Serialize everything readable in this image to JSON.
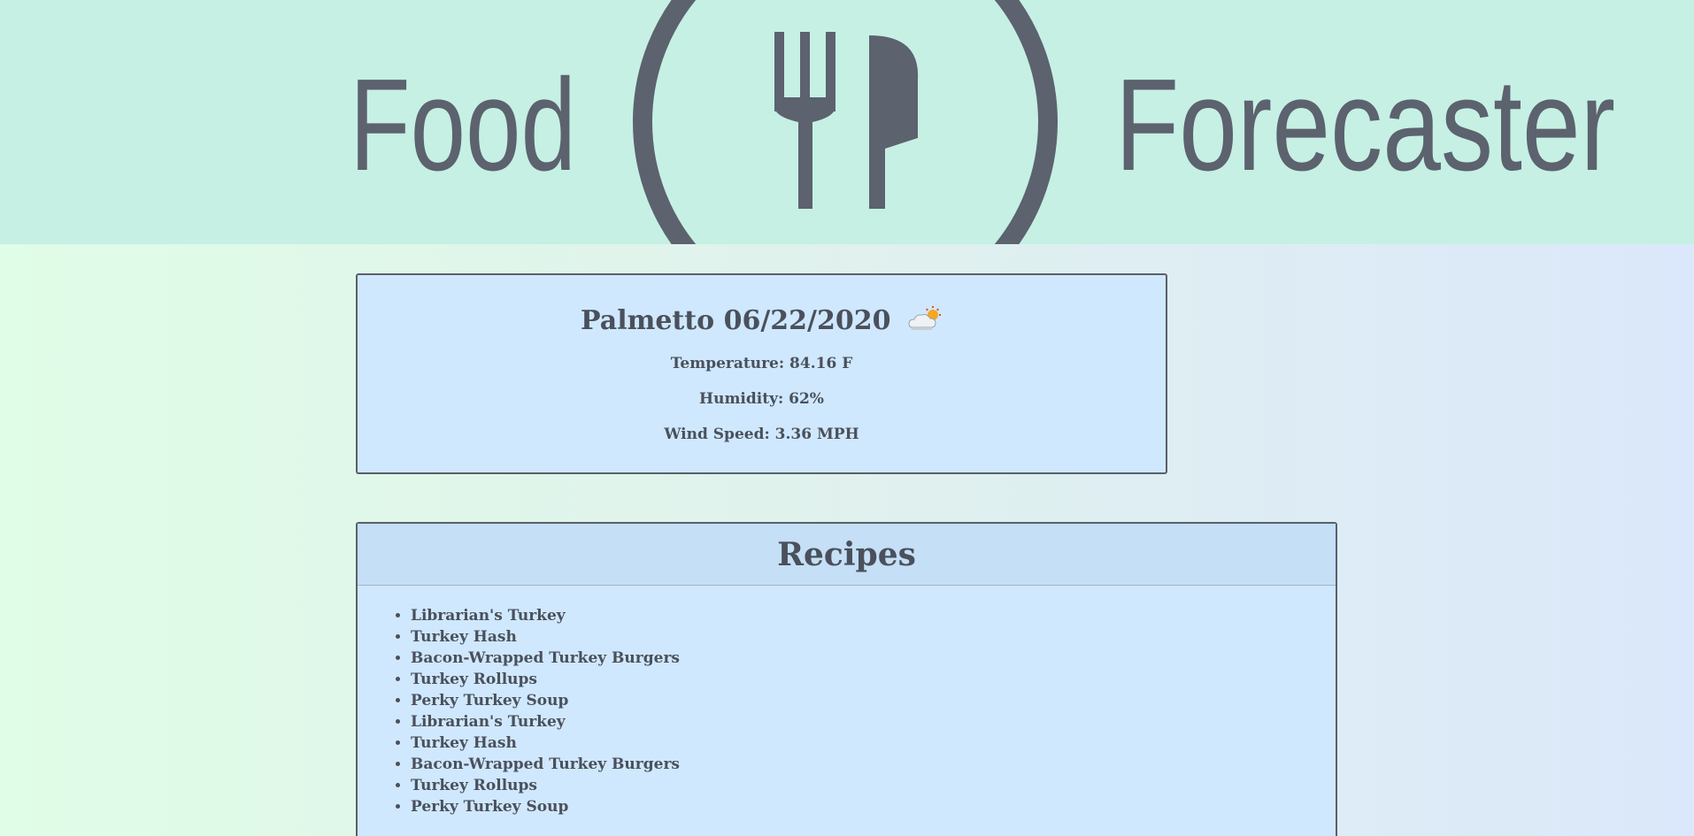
{
  "header": {
    "logo_left_text": "Food",
    "logo_right_text": "Forecaster",
    "logo_color": "#5c626e",
    "background": "#c6f0e4"
  },
  "weather": {
    "city_date": "Palmetto 06/22/2020",
    "icon": "cloud-sun-icon",
    "temperature": "Temperature: 84.16 F",
    "humidity": "Humidity: 62%",
    "wind_speed": "Wind Speed: 3.36 MPH"
  },
  "recipes": {
    "title": "Recipes",
    "items": [
      "Librarian's Turkey",
      "Turkey Hash",
      "Bacon-Wrapped Turkey Burgers",
      "Turkey Rollups",
      "Perky Turkey Soup",
      "Librarian's Turkey",
      "Turkey Hash",
      "Bacon-Wrapped Turkey Burgers",
      "Turkey Rollups",
      "Perky Turkey Soup"
    ]
  }
}
